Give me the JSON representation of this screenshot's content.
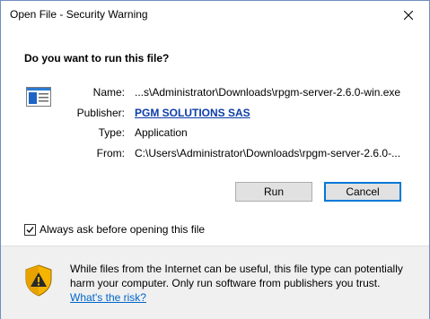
{
  "window": {
    "title": "Open File - Security Warning"
  },
  "dialog": {
    "question": "Do you want to run this file?",
    "fields": [
      {
        "label": "Name:",
        "value": "...s\\Administrator\\Downloads\\rpgm-server-2.6.0-win.exe"
      },
      {
        "label": "Publisher:",
        "value": "PGM SOLUTIONS SAS"
      },
      {
        "label": "Type:",
        "value": "Application"
      },
      {
        "label": "From:",
        "value": "C:\\Users\\Administrator\\Downloads\\rpgm-server-2.6.0-..."
      }
    ],
    "run_label": "Run",
    "cancel_label": "Cancel",
    "checkbox_label": "Always ask before opening this file",
    "checkbox_checked": true,
    "warning_text": "While files from the Internet can be useful, this file type can potentially harm your computer. Only run software from publishers you trust.",
    "risk_link": "What's the risk?"
  },
  "icons": {
    "close": "close-icon",
    "file": "application-file-icon",
    "shield": "security-shield-icon",
    "check": "checkmark-icon"
  }
}
